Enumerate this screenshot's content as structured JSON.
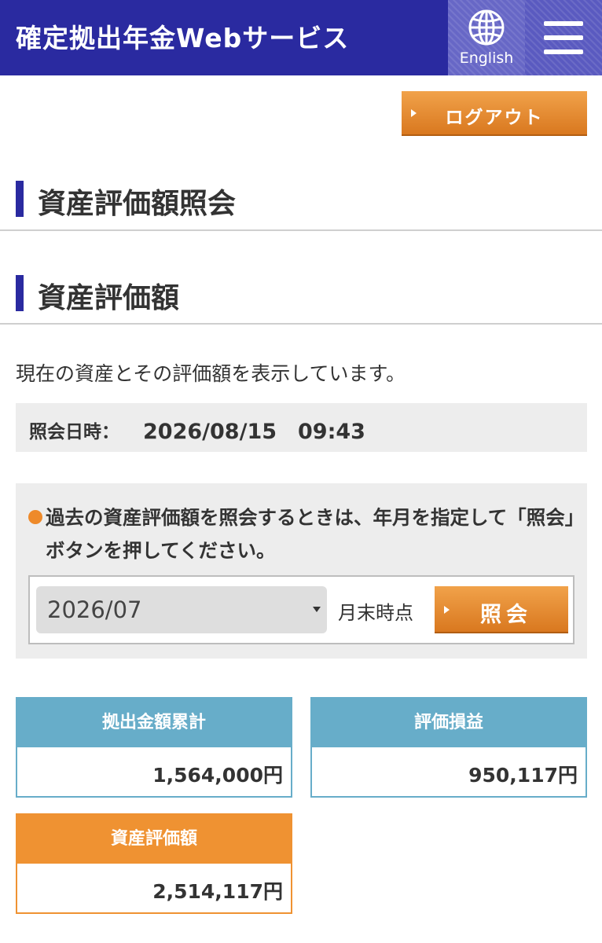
{
  "header": {
    "title": "確定拠出年金Webサービス",
    "language_label": "English"
  },
  "logout_label": "ログアウト",
  "page_title": "資産評価額照会",
  "section_title": "資産評価額",
  "description": "現在の資産とその評価額を表示しています。",
  "inquiry": {
    "label": "照会日時：",
    "value": "2026/08/15　09:43"
  },
  "query": {
    "note": "過去の資産評価額を照会するときは、年月を指定して「照会」ボタンを押してください。",
    "selected_month": "2026/07",
    "suffix": "月末時点",
    "button_label": "照会"
  },
  "cards": {
    "contributions": {
      "title": "拠出金額累計",
      "value": "1,564,000円"
    },
    "gain": {
      "title": "評価損益",
      "value": "950,117円"
    },
    "asset_value": {
      "title": "資産評価額",
      "value": "2,514,117円"
    }
  },
  "colors": {
    "header_bg": "#2a2aa0",
    "accent_orange": "#e8862a",
    "card_blue": "#67adc9",
    "card_orange": "#ef9232"
  },
  "icons": {
    "language": "globe-icon",
    "menu": "hamburger-menu-icon",
    "button_marker": "triangle-right-icon",
    "note_marker": "bullet-dot-icon"
  }
}
